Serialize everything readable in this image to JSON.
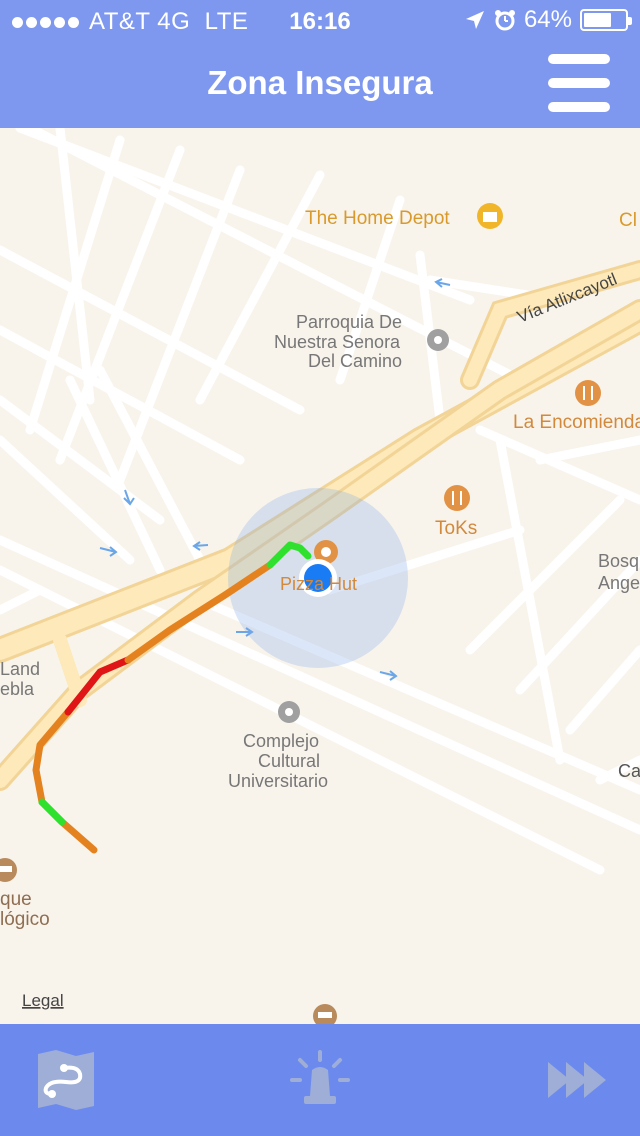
{
  "status_bar": {
    "signal_dots": 5,
    "carrier": "AT&T 4G  LTE",
    "time": "16:16",
    "battery": "64%",
    "battery_level": 0.64,
    "icons": [
      "location-arrow-icon",
      "alarm-clock-icon",
      "battery-icon"
    ]
  },
  "navbar": {
    "title": "Zona Insegura",
    "menu_icon": "hamburger-menu-icon"
  },
  "map": {
    "places": {
      "home_depot": "The Home Depot",
      "parroquia_1": "Parroquia De",
      "parroquia_2": "Nuestra Senora",
      "parroquia_3": "Del Camino",
      "encomienda": "La Encomienda",
      "toks": "ToKs",
      "pizza_hut": "Pizza Hut",
      "complejo_1": "Complejo",
      "complejo_2": "Cultural",
      "complejo_3": "Universitario",
      "land_1": "Land",
      "land_2": "ebla",
      "bosque_1": "Bosq",
      "bosque_2": "Ange",
      "parque_1": "que",
      "parque_2": "lógico",
      "ca": "Ca",
      "cl": "Cl",
      "via_atlixcayotl": "Vía Atlixcayotl"
    },
    "legal_link": "Legal",
    "colors": {
      "route_safe": "#2fe02f",
      "route_warning": "#e4821f",
      "route_danger": "#e01515",
      "user_location": "#1a7cf5",
      "poi_orange": "#e29244",
      "poi_gray": "#9a9a9a"
    }
  },
  "tab_bar": {
    "tabs": [
      {
        "icon": "route-map-icon"
      },
      {
        "icon": "siren-alert-icon"
      },
      {
        "icon": "fast-forward-icon"
      }
    ]
  }
}
